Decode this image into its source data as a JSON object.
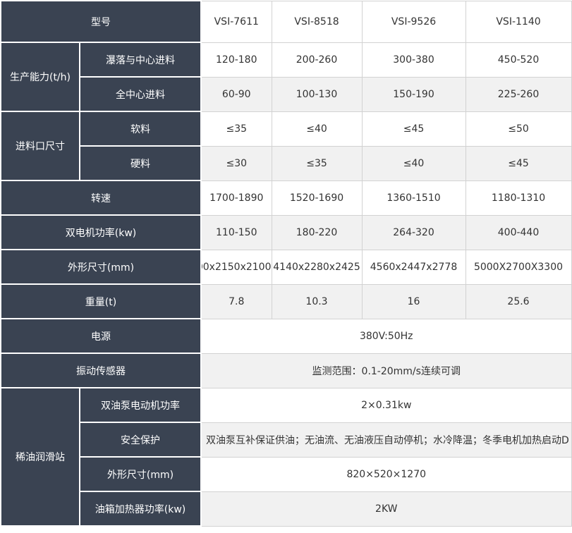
{
  "columns": [
    "VSI-7611",
    "VSI-8518",
    "VSI-9526",
    "VSI-1140"
  ],
  "header_label": "型号",
  "capacity": {
    "group": "生产能力(t/h)",
    "cascade": {
      "label": "瀑落与中心进料",
      "values": [
        "120-180",
        "200-260",
        "300-380",
        "450-520"
      ]
    },
    "center": {
      "label": "全中心进料",
      "values": [
        "60-90",
        "100-130",
        "150-190",
        "225-260"
      ]
    }
  },
  "inlet": {
    "group": "进料口尺寸",
    "soft": {
      "label": "软料",
      "values": [
        "≤35",
        "≤40",
        "≤45",
        "≤50"
      ]
    },
    "hard": {
      "label": "硬料",
      "values": [
        "≤30",
        "≤35",
        "≤40",
        "≤45"
      ]
    }
  },
  "speed": {
    "label": "转速",
    "values": [
      "1700-1890",
      "1520-1690",
      "1360-1510",
      "1180-1310"
    ]
  },
  "power": {
    "label": "双电机功率(kw)",
    "values": [
      "110-150",
      "180-220",
      "264-320",
      "400-440"
    ]
  },
  "dimensions": {
    "label": "外形尺寸(mm)",
    "values": [
      "00x2150x2100",
      "4140x2280x2425",
      "4560x2447x2778",
      "5000X2700X3300"
    ]
  },
  "weight": {
    "label": "重量(t)",
    "values": [
      "7.8",
      "10.3",
      "16",
      "25.6"
    ]
  },
  "power_supply": {
    "label": "电源",
    "value": "380V:50Hz"
  },
  "vibration": {
    "label": "振动传感器",
    "value": "监测范围：0.1-20mm/s连续可调"
  },
  "lube": {
    "group": "稀油润滑站",
    "pump_power": {
      "label": "双油泵电动机功率",
      "value": "2×0.31kw"
    },
    "safety": {
      "label": "安全保护",
      "value": "双油泵互补保证供油；无油流、无油液压自动停机；水冷降温；冬季电机加热启动D"
    },
    "size": {
      "label": "外形尺寸(mm)",
      "value": "820×520×1270"
    },
    "heater": {
      "label": "油箱加热器功率(kw)",
      "value": "2KW"
    }
  }
}
